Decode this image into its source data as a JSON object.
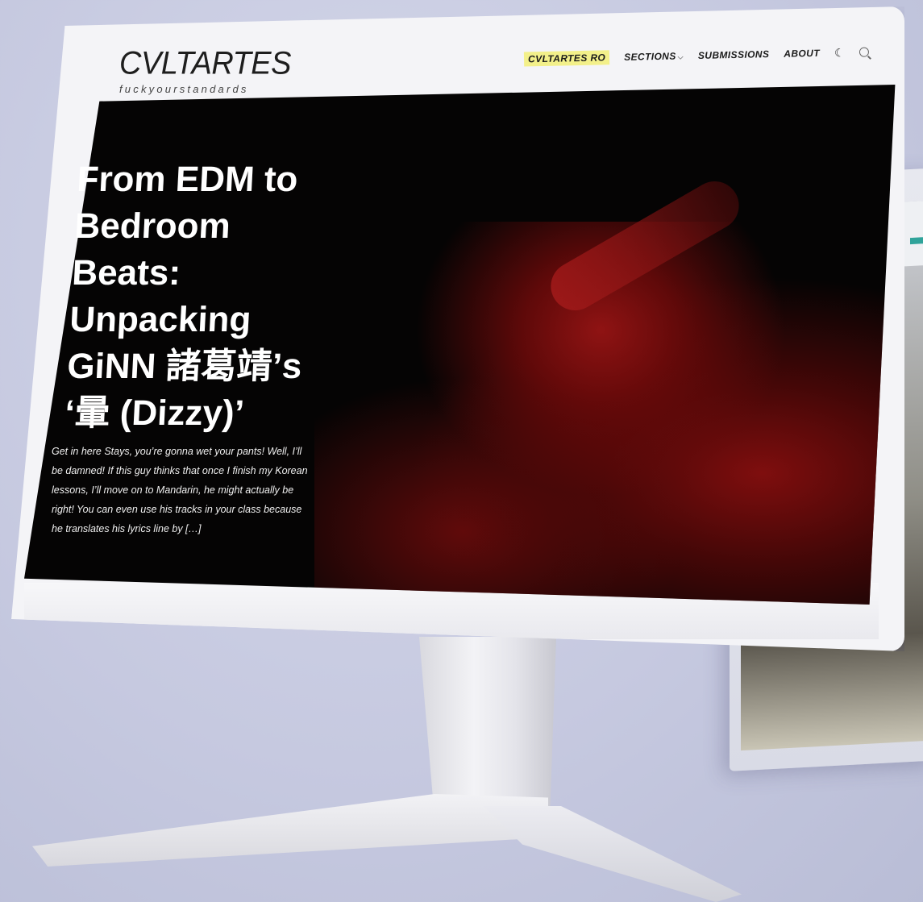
{
  "site": {
    "title": "CVLTARTES",
    "tagline": "fuckyourstandards"
  },
  "nav": {
    "items": [
      {
        "label": "CVLTARTES RO",
        "highlighted": true
      },
      {
        "label": "SECTIONS",
        "has_dropdown": true
      },
      {
        "label": "SUBMISSIONS"
      },
      {
        "label": "ABOUT"
      }
    ],
    "icons": [
      "moon-icon",
      "search-icon"
    ]
  },
  "hero": {
    "title": "From EDM to Bedroom Beats: Unpacking GiNN 諸葛靖’s ‘暈 (Dizzy)’",
    "excerpt": "Get in here Stays, you’re gonna wet your pants! Well, I’ll be damned! If this guy thinks that once I finish my Korean lessons, I’ll move on to Mandarin, he might actually be right! You can even use his tracks in your class because he translates his lyrics line by […]"
  },
  "colors": {
    "highlight": "#f3f08a",
    "hero_bg": "#050404",
    "hero_red": "#8c0f0f"
  }
}
